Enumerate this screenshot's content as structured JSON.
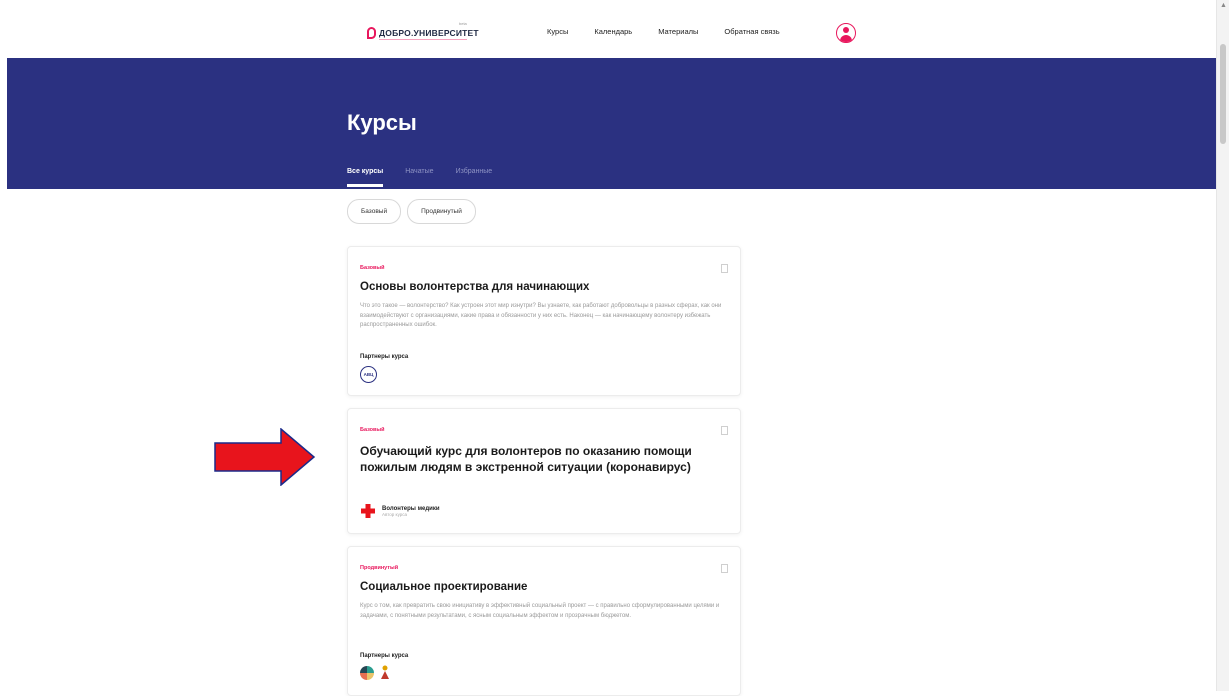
{
  "header": {
    "logo_text": "ДОБРО.УНИВЕРСИТЕТ",
    "logo_beta": "beta",
    "nav": [
      "Курсы",
      "Календарь",
      "Материалы",
      "Обратная связь"
    ]
  },
  "hero": {
    "title": "Курсы",
    "tabs": [
      "Все курсы",
      "Начатые",
      "Избранные"
    ]
  },
  "filters": [
    "Базовый",
    "Продвинутый"
  ],
  "courses": [
    {
      "level": "Базовый",
      "title": "Основы волонтерства для начинающих",
      "description": "Что это такое — волонтерство? Как устроен этот мир изнутри? Вы узнаете, как работают добровольцы в разных сферах, как они взаимодействуют с организациями, какие права и обязанности у них есть. Наконец — как начинающему волонтеру избежать распространенных ошибок.",
      "partners_label": "Партнеры курса",
      "partner_logo_text": "АВЦ"
    },
    {
      "level": "Базовый",
      "title": "Обучающий курс для волонтеров по оказанию помощи пожилым людям в экстренной ситуации (коронавирус)",
      "author_name": "Волонтеры медики",
      "author_role": "Автор курса"
    },
    {
      "level": "Продвинутый",
      "title": "Социальное проектирование",
      "description": "Курс о том, как превратить свою инициативу в эффективный социальный проект — с правильно сформулированными целями и задачами, с понятными результатами, с ясным социальным эффектом и прозрачным бюджетом.",
      "partners_label": "Партнеры курса"
    }
  ],
  "colors": {
    "brand_blue": "#2b3181",
    "accent_pink": "#e8175d",
    "arrow_red": "#e8141c"
  }
}
